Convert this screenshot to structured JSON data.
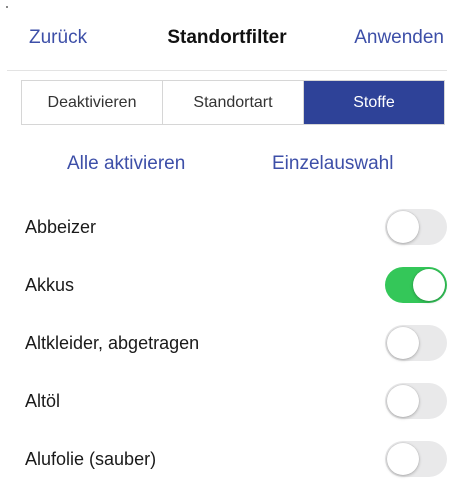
{
  "header": {
    "back_label": "Zurück",
    "title": "Standortfilter",
    "apply_label": "Anwenden"
  },
  "segments": [
    {
      "label": "Deaktivieren",
      "selected": false
    },
    {
      "label": "Standortart",
      "selected": false
    },
    {
      "label": "Stoffe",
      "selected": true
    }
  ],
  "bulk_actions": {
    "activate_all_label": "Alle aktivieren",
    "single_select_label": "Einzelauswahl"
  },
  "items": [
    {
      "label": "Abbeizer",
      "enabled": false
    },
    {
      "label": "Akkus",
      "enabled": true
    },
    {
      "label": "Altkleider, abgetragen",
      "enabled": false
    },
    {
      "label": "Altöl",
      "enabled": false
    },
    {
      "label": "Alufolie (sauber)",
      "enabled": false
    }
  ],
  "colors": {
    "accent": "#3d4fa8",
    "segment_active": "#2e4298",
    "toggle_on": "#34c759",
    "toggle_off": "#e9e9ea"
  }
}
